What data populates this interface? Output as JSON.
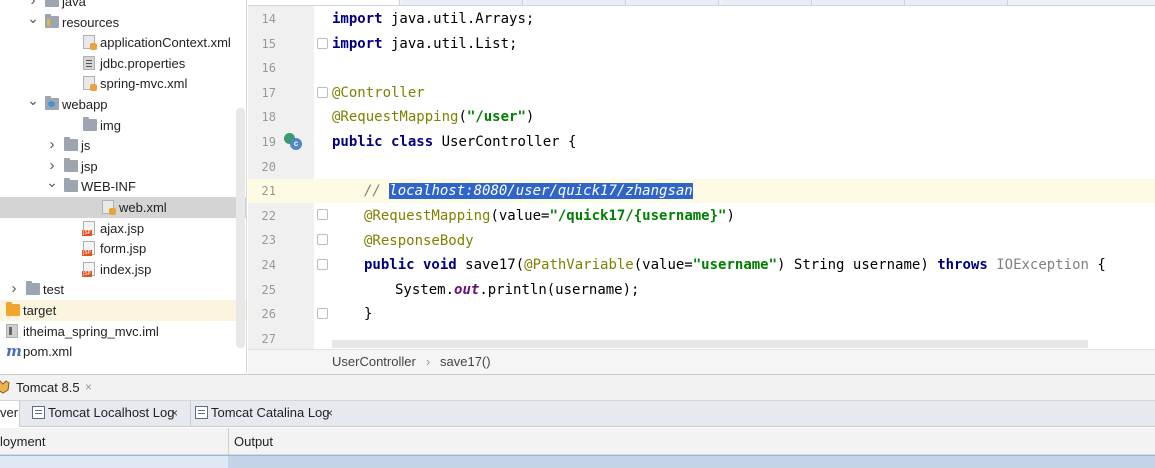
{
  "project_tree": [
    {
      "label": "java",
      "icon": "folder-icon",
      "arrow": "collapsed",
      "level": 1
    },
    {
      "label": "resources",
      "icon": "resources-folder-icon",
      "arrow": "expanded",
      "level": 1
    },
    {
      "label": "applicationContext.xml",
      "icon": "xml-file-icon",
      "arrow": "",
      "level": 3
    },
    {
      "label": "jdbc.properties",
      "icon": "properties-file-icon",
      "arrow": "",
      "level": 3
    },
    {
      "label": "spring-mvc.xml",
      "icon": "xml-file-icon",
      "arrow": "",
      "level": 3
    },
    {
      "label": "webapp",
      "icon": "web-folder-icon",
      "arrow": "expanded",
      "level": 1
    },
    {
      "label": "img",
      "icon": "folder-icon",
      "arrow": "",
      "level": 3
    },
    {
      "label": "js",
      "icon": "folder-icon",
      "arrow": "collapsed",
      "level": 2
    },
    {
      "label": "jsp",
      "icon": "folder-icon",
      "arrow": "collapsed",
      "level": 2
    },
    {
      "label": "WEB-INF",
      "icon": "folder-icon",
      "arrow": "expanded",
      "level": 2
    },
    {
      "label": "web.xml",
      "icon": "xml-file-icon",
      "arrow": "",
      "level": 4,
      "selected": true
    },
    {
      "label": "ajax.jsp",
      "icon": "jsp-file-icon",
      "arrow": "",
      "level": 3
    },
    {
      "label": "form.jsp",
      "icon": "jsp-file-icon",
      "arrow": "",
      "level": 3
    },
    {
      "label": "index.jsp",
      "icon": "jsp-file-icon",
      "arrow": "",
      "level": 3
    },
    {
      "label": "test",
      "icon": "folder-icon",
      "arrow": "collapsed",
      "level": 0
    },
    {
      "label": "target",
      "icon": "excluded-folder-icon",
      "arrow": "",
      "level": -1,
      "excluded": true
    },
    {
      "label": "itheima_spring_mvc.iml",
      "icon": "iml-file-icon",
      "arrow": "",
      "level": -1
    },
    {
      "label": "pom.xml",
      "icon": "maven-icon",
      "arrow": "",
      "level": -1
    }
  ],
  "editor": {
    "line_numbers": [
      "14",
      "15",
      "16",
      "17",
      "18",
      "19",
      "20",
      "21",
      "22",
      "23",
      "24",
      "25",
      "26",
      "27"
    ],
    "code": {
      "l14_kw": "import",
      "l14_rest": " java.util.Arrays;",
      "l15_kw": "import",
      "l15_rest": " java.util.List;",
      "l17_ann": "@Controller",
      "l18_ann": "@RequestMapping",
      "l18_p1": "(",
      "l18_str": "\"/user\"",
      "l18_p2": ")",
      "l19_kw": "public class",
      "l19_rest": " UserController {",
      "l21_cmt": "// ",
      "l21_sel": "localhost:8080/user/quick17/zhangsan",
      "l22_ann": "@RequestMapping",
      "l22_p1": "(value=",
      "l22_str": "\"/quick17/{username}\"",
      "l22_p2": ")",
      "l23_ann": "@ResponseBody",
      "l24_kw": "public void",
      "l24_a": " save17(",
      "l24_ann": "@PathVariable",
      "l24_b": "(value=",
      "l24_str": "\"username\"",
      "l24_c": ") String username) ",
      "l24_kw2": "throws",
      "l24_sp": " ",
      "l24_exc": "IOException",
      "l24_d": " {",
      "l25_a": "System.",
      "l25_fld": "out",
      "l25_b": ".println(username);",
      "l26": "}"
    }
  },
  "breadcrumb": {
    "class_name": "UserController",
    "separator": "›",
    "method": "save17()"
  },
  "run_panel": {
    "config_name": "Tomcat 8.5",
    "close": "×",
    "tabs": [
      {
        "label": "ver",
        "active": true
      },
      {
        "label": "Tomcat Localhost Log",
        "close": "×"
      },
      {
        "label": "Tomcat Catalina Log",
        "close": "×"
      }
    ],
    "columns": {
      "deployment": "loyment",
      "output": "Output"
    }
  }
}
